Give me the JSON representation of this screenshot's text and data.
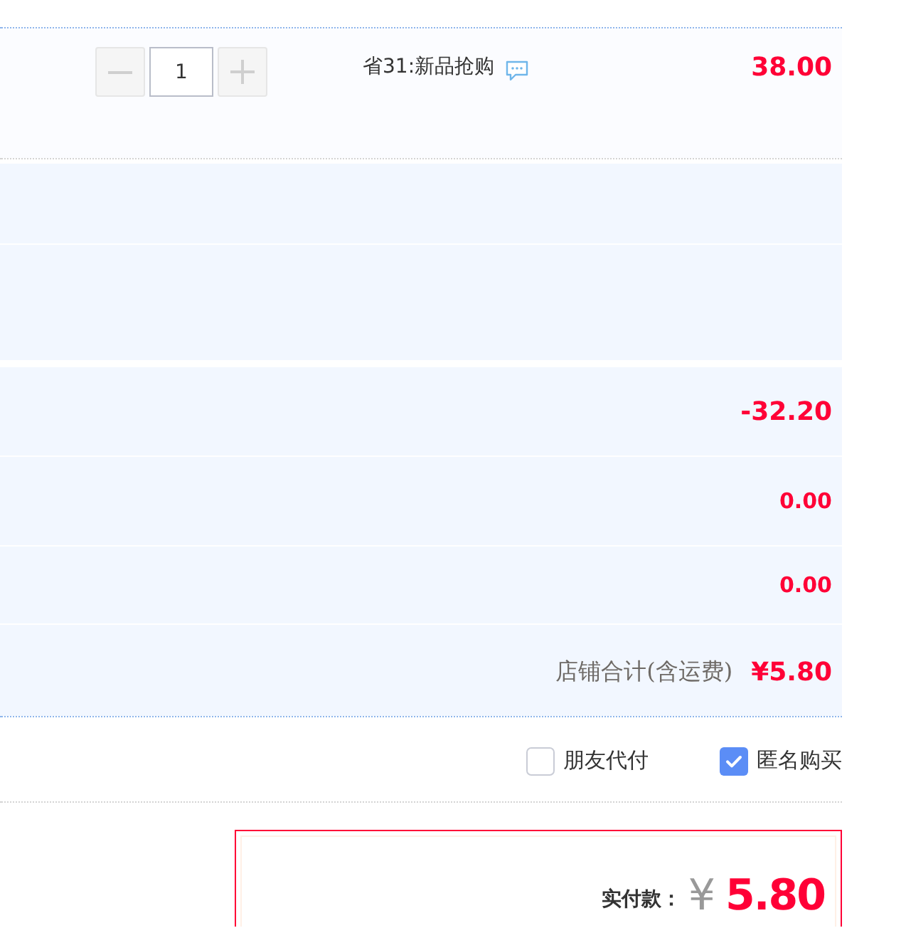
{
  "item": {
    "quantity": {
      "value": "1"
    },
    "promo": "省31:新品抢购",
    "price": "38.00"
  },
  "summary_rows": [
    {
      "kind": "blank"
    },
    {
      "kind": "blank"
    },
    {
      "kind": "amount",
      "amount": "-32.20"
    },
    {
      "kind": "amount",
      "amount": "0.00"
    },
    {
      "kind": "amount",
      "amount": "0.00"
    }
  ],
  "shop_total": {
    "label": "店铺合计(含运费)",
    "amount": "¥5.80"
  },
  "options": [
    {
      "label": "朋友代付",
      "checked": false
    },
    {
      "label": "匿名购买",
      "checked": true
    }
  ],
  "payment": {
    "label": "实付款：",
    "currency": "¥",
    "amount": "5.80"
  }
}
